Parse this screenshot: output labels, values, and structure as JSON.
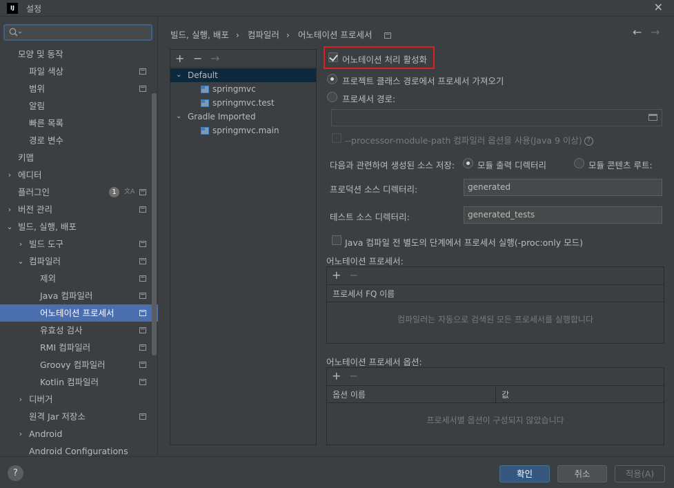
{
  "window": {
    "title": "설정",
    "app_icon": "IJ"
  },
  "search": {
    "value": "",
    "placeholder": ""
  },
  "sidebar": {
    "items": [
      {
        "label": "모양 및 동작",
        "level": 0,
        "expand": "",
        "icon": false
      },
      {
        "label": "파일 색상",
        "level": 1,
        "expand": "",
        "icon": true
      },
      {
        "label": "범위",
        "level": 1,
        "expand": "",
        "icon": true
      },
      {
        "label": "알림",
        "level": 1,
        "expand": "",
        "icon": false
      },
      {
        "label": "빠른 목록",
        "level": 1,
        "expand": "",
        "icon": false
      },
      {
        "label": "경로 변수",
        "level": 1,
        "expand": "",
        "icon": false
      },
      {
        "label": "키맵",
        "level": 0,
        "expand": "",
        "icon": false
      },
      {
        "label": "에디터",
        "level": 0,
        "expand": "collapsed",
        "icon": false
      },
      {
        "label": "플러그인",
        "level": 0,
        "expand": "",
        "icon": true,
        "badge": "1"
      },
      {
        "label": "버전 관리",
        "level": 0,
        "expand": "collapsed",
        "icon": true
      },
      {
        "label": "빌드, 실행, 배포",
        "level": 0,
        "expand": "expanded",
        "icon": false
      },
      {
        "label": "빌드 도구",
        "level": 1,
        "expand": "collapsed",
        "icon": true
      },
      {
        "label": "컴파일러",
        "level": 1,
        "expand": "expanded",
        "icon": true
      },
      {
        "label": "제외",
        "level": 2,
        "expand": "",
        "icon": true
      },
      {
        "label": "Java 컴파일러",
        "level": 2,
        "expand": "",
        "icon": true
      },
      {
        "label": "어노테이션 프로세서",
        "level": 2,
        "expand": "",
        "icon": true,
        "selected": true
      },
      {
        "label": "유효성 검사",
        "level": 2,
        "expand": "",
        "icon": true
      },
      {
        "label": "RMI 컴파일러",
        "level": 2,
        "expand": "",
        "icon": true
      },
      {
        "label": "Groovy 컴파일러",
        "level": 2,
        "expand": "",
        "icon": true
      },
      {
        "label": "Kotlin 컴파일러",
        "level": 2,
        "expand": "",
        "icon": true
      },
      {
        "label": "디버거",
        "level": 1,
        "expand": "collapsed",
        "icon": false
      },
      {
        "label": "원격 Jar 저장소",
        "level": 1,
        "expand": "",
        "icon": true
      },
      {
        "label": "Android",
        "level": 1,
        "expand": "collapsed",
        "icon": false
      },
      {
        "label": "Android Configurations",
        "level": 1,
        "expand": "",
        "icon": false
      }
    ]
  },
  "breadcrumb": [
    "빌드, 실행, 배포",
    "컴파일러",
    "어노테이션 프로세서"
  ],
  "profiles": {
    "toolbar": {
      "add": "+",
      "remove": "−",
      "move": "→"
    },
    "items": [
      {
        "label": "Default",
        "level": 0,
        "expand": "expanded",
        "selected": true,
        "module": false
      },
      {
        "label": "springmvc",
        "level": 1,
        "expand": "",
        "selected": false,
        "module": true
      },
      {
        "label": "springmvc.test",
        "level": 1,
        "expand": "",
        "selected": false,
        "module": true
      },
      {
        "label": "Gradle Imported",
        "level": 0,
        "expand": "expanded",
        "selected": false,
        "module": false
      },
      {
        "label": "springmvc.main",
        "level": 1,
        "expand": "",
        "selected": false,
        "module": true
      }
    ]
  },
  "settings": {
    "enable_processing": {
      "label": "어노테이션 처리 활성화",
      "checked": true
    },
    "obtain_from_classpath": {
      "label": "프로젝트 클래스 경로에서 프로세서 가져오기",
      "selected": true
    },
    "processor_path": {
      "label": "프로세서 경로:",
      "selected": false,
      "value": ""
    },
    "module_path_option": {
      "label": "--processor-module-path 컴파일러 옵션을 사용(Java 9 이상)",
      "checked": false
    },
    "store_generated": {
      "label": "다음과 관련하여 생성된 소스 저장:",
      "option_output": "모듈 출력 디렉터리",
      "option_content_root": "모듈 콘텐츠 루트:",
      "selected": "option_output"
    },
    "production_dir": {
      "label": "프로덕션 소스 디렉터리:",
      "value": "generated"
    },
    "test_dir": {
      "label": "테스트 소스 디렉터리:",
      "value": "generated_tests"
    },
    "proc_only": {
      "label": "Java 컴파일 전 별도의 단계에서 프로세서 실행(-proc:only 모드)",
      "checked": false
    }
  },
  "processors_table": {
    "title": "어노테이션 프로세서:",
    "add": "+",
    "remove": "−",
    "column": "프로세서 FQ 이름",
    "empty_text": "컴파일러는 자동으로 검색된 모든 프로세서를 실행합니다"
  },
  "options_table": {
    "title": "어노테이션 프로세서 옵션:",
    "add": "+",
    "remove": "−",
    "columns": [
      "옵션 이름",
      "값"
    ],
    "empty_text": "프로세서별 옵션이 구성되지 않았습니다"
  },
  "buttons": {
    "help": "?",
    "ok": "확인",
    "cancel": "취소",
    "apply": "적용(A)"
  },
  "colors": {
    "background": "#3c3f41",
    "selection": "#4b6eaf",
    "highlight_border": "#e02020",
    "primary_button": "#365880"
  }
}
